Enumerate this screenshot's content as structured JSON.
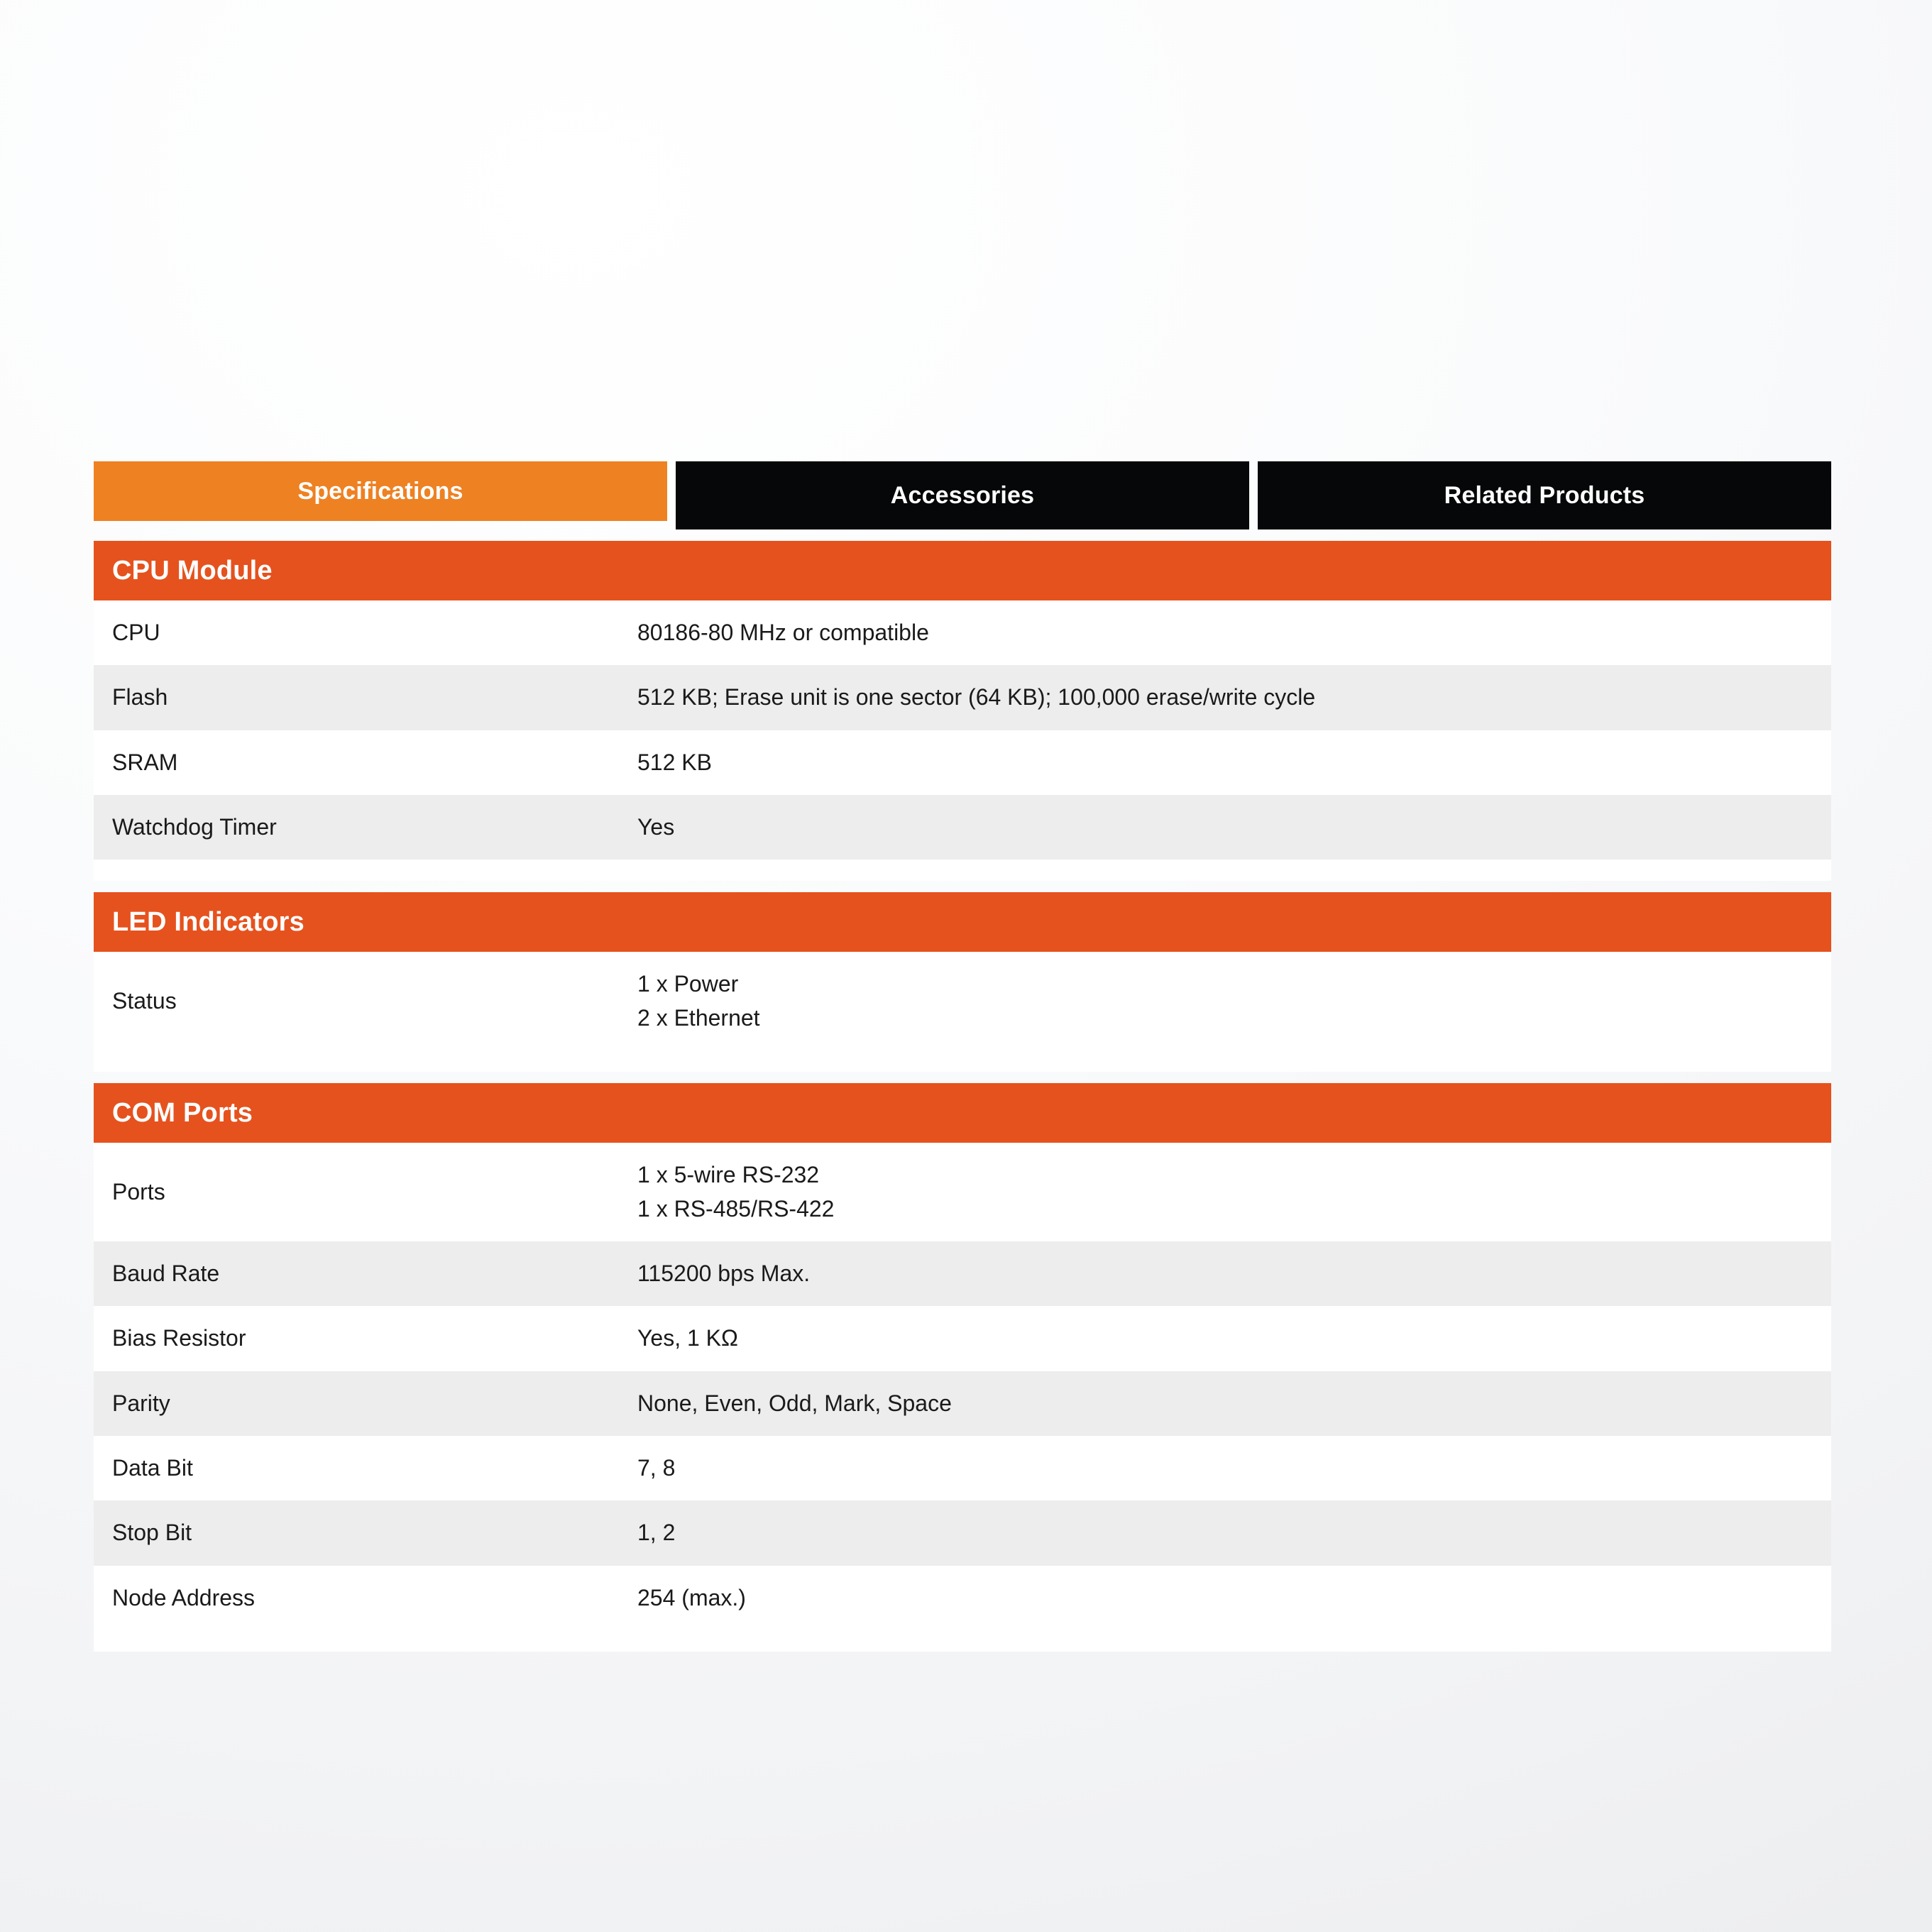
{
  "tabs": [
    {
      "label": "Specifications",
      "state": "active"
    },
    {
      "label": "Accessories",
      "state": "inactive"
    },
    {
      "label": "Related Products",
      "state": "inactive"
    }
  ],
  "colors": {
    "tab_active_bg": "#ee8122",
    "tab_inactive_bg": "#050708",
    "section_header_bg": "#e5521e",
    "row_odd_bg": "#ffffff",
    "row_even_bg": "#ededed",
    "text": "#1a1a1a",
    "tab_text": "#ffffff"
  },
  "sections": [
    {
      "title": "CPU Module",
      "rows": [
        {
          "label": "CPU",
          "value": "80186-80 MHz or compatible"
        },
        {
          "label": "Flash",
          "value": "512 KB; Erase unit is one sector (64 KB); 100,000 erase/write cycle"
        },
        {
          "label": "SRAM",
          "value": "512 KB"
        },
        {
          "label": "Watchdog Timer",
          "value": "Yes"
        }
      ]
    },
    {
      "title": "LED Indicators",
      "rows": [
        {
          "label": "Status",
          "value": "1 x Power\n2 x Ethernet"
        }
      ]
    },
    {
      "title": "COM Ports",
      "rows": [
        {
          "label": "Ports",
          "value": "1 x 5-wire RS-232\n1 x RS-485/RS-422"
        },
        {
          "label": "Baud Rate",
          "value": "115200 bps Max."
        },
        {
          "label": "Bias Resistor",
          "value": "Yes, 1 KΩ"
        },
        {
          "label": "Parity",
          "value": "None, Even, Odd, Mark, Space"
        },
        {
          "label": "Data Bit",
          "value": "7, 8"
        },
        {
          "label": "Stop Bit",
          "value": "1, 2"
        },
        {
          "label": "Node Address",
          "value": "254 (max.)"
        }
      ]
    }
  ]
}
